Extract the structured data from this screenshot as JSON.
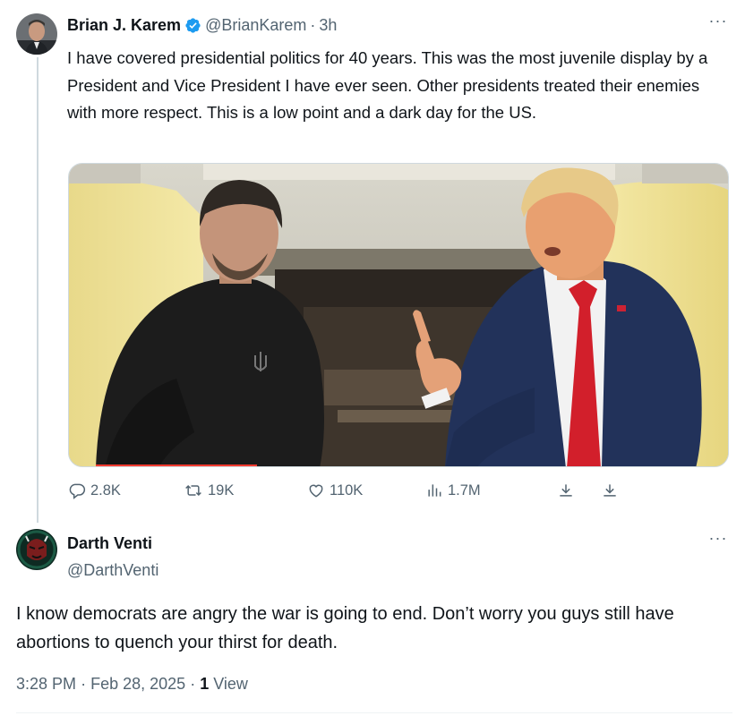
{
  "tweet": {
    "author": {
      "display_name": "Brian J. Karem",
      "handle": "@BrianKarem",
      "verified": true,
      "verified_icon": "verified-badge-icon",
      "verified_color": "#1d9bf0"
    },
    "separator": "·",
    "time_ago": "3h",
    "more_label": "···",
    "text": "I have covered presidential politics for 40 years. This was the most juvenile display by a President and Vice President I have ever seen. Other presidents treated their enemies with more respect. This is a low point and a dark day for the US.",
    "media": {
      "type": "photo",
      "alt_subject": "two men seated in conversation, one pointing a finger"
    },
    "actions": {
      "replies": "2.8K",
      "retweets": "19K",
      "likes": "110K",
      "views": "1.7M"
    }
  },
  "reply": {
    "author": {
      "display_name": "Darth Venti",
      "handle": "@DarthVenti"
    },
    "more_label": "···",
    "text": "I know democrats are angry the war is going to end. Don’t worry you guys still have abortions to quench your thirst for death.",
    "meta": {
      "time": "3:28 PM",
      "separator": "·",
      "date": "Feb 28, 2025",
      "separator2": "·",
      "view_count": "1",
      "view_label": "View"
    }
  },
  "colors": {
    "text_primary": "#0f1419",
    "text_secondary": "#536471",
    "accent": "#1d9bf0",
    "divider": "#cfd9de"
  },
  "icons": [
    "reply-icon",
    "retweet-icon",
    "like-icon",
    "views-icon",
    "bookmark-icon",
    "share-icon",
    "more-icon"
  ]
}
